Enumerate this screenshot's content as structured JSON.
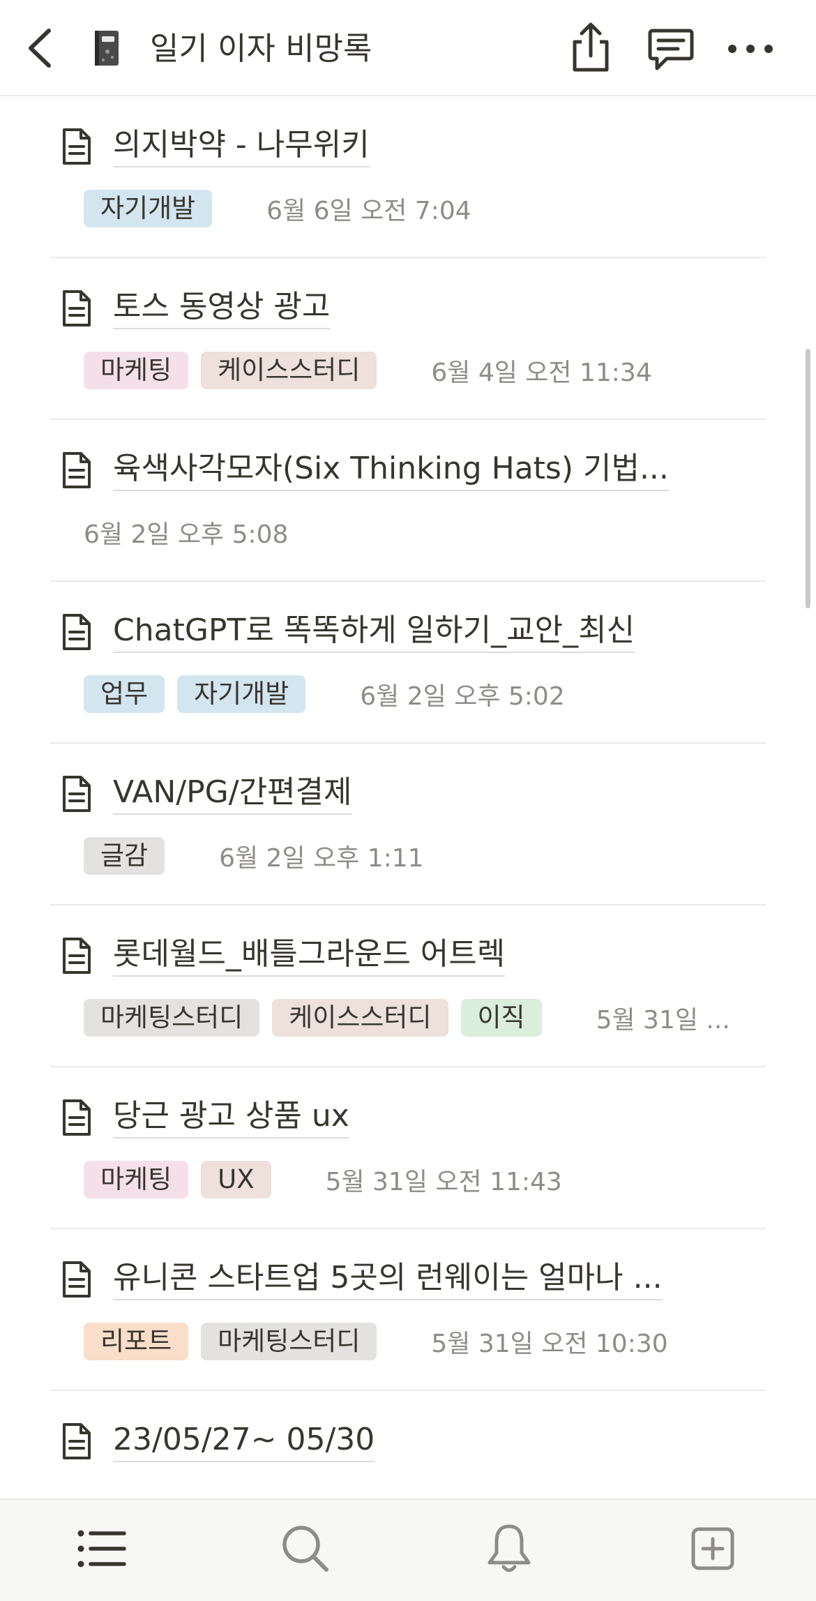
{
  "header": {
    "title": "일기 이자 비망록"
  },
  "rows": [
    {
      "title": "의지박약 - 나무위키",
      "tags": [
        {
          "label": "자기개발",
          "color": "#d3e5ef"
        }
      ],
      "date": "6월 6일 오전 7:04"
    },
    {
      "title": "토스 동영상 광고",
      "tags": [
        {
          "label": "마케팅",
          "color": "#f5e0e9"
        },
        {
          "label": "케이스스터디",
          "color": "#eee0da"
        }
      ],
      "date": "6월 4일 오전 11:34"
    },
    {
      "title": "육색사각모자(Six Thinking Hats) 기법...",
      "tags": [],
      "date": "6월 2일 오후 5:08"
    },
    {
      "title": "ChatGPT로 똑똑하게 일하기_교안_최신",
      "tags": [
        {
          "label": "업무",
          "color": "#d3e5ef"
        },
        {
          "label": "자기개발",
          "color": "#d3e5ef"
        }
      ],
      "date": "6월 2일 오후 5:02"
    },
    {
      "title": "VAN/PG/간편결제",
      "tags": [
        {
          "label": "글감",
          "color": "#e3e2e0"
        }
      ],
      "date": "6월 2일 오후 1:11"
    },
    {
      "title": "롯데월드_배틀그라운드 어트렉",
      "tags": [
        {
          "label": "마케팅스터디",
          "color": "#e3e2e0"
        },
        {
          "label": "케이스스터디",
          "color": "#eee0da"
        },
        {
          "label": "이직",
          "color": "#dbeddb"
        }
      ],
      "date": "5월 31일 ..."
    },
    {
      "title": "당근 광고 상품 ux",
      "tags": [
        {
          "label": "마케팅",
          "color": "#f5e0e9"
        },
        {
          "label": "UX",
          "color": "#eee0da"
        }
      ],
      "date": "5월 31일 오전 11:43"
    },
    {
      "title": "유니콘 스타트업 5곳의 런웨이는 얼마나 ...",
      "tags": [
        {
          "label": "리포트",
          "color": "#fadec9"
        },
        {
          "label": "마케팅스터디",
          "color": "#e3e2e0"
        }
      ],
      "date": "5월 31일 오전 10:30"
    },
    {
      "title": "23/05/27~ 05/30",
      "tags": [],
      "date": ""
    }
  ],
  "icons": {
    "back": "chevron-left-icon",
    "page": "notebook-icon",
    "share": "share-icon",
    "comment": "comment-icon",
    "more": "more-icon",
    "doc": "document-icon",
    "tab_list": "list-icon",
    "tab_search": "search-icon",
    "tab_bell": "bell-icon",
    "tab_add": "plus-square-icon"
  }
}
